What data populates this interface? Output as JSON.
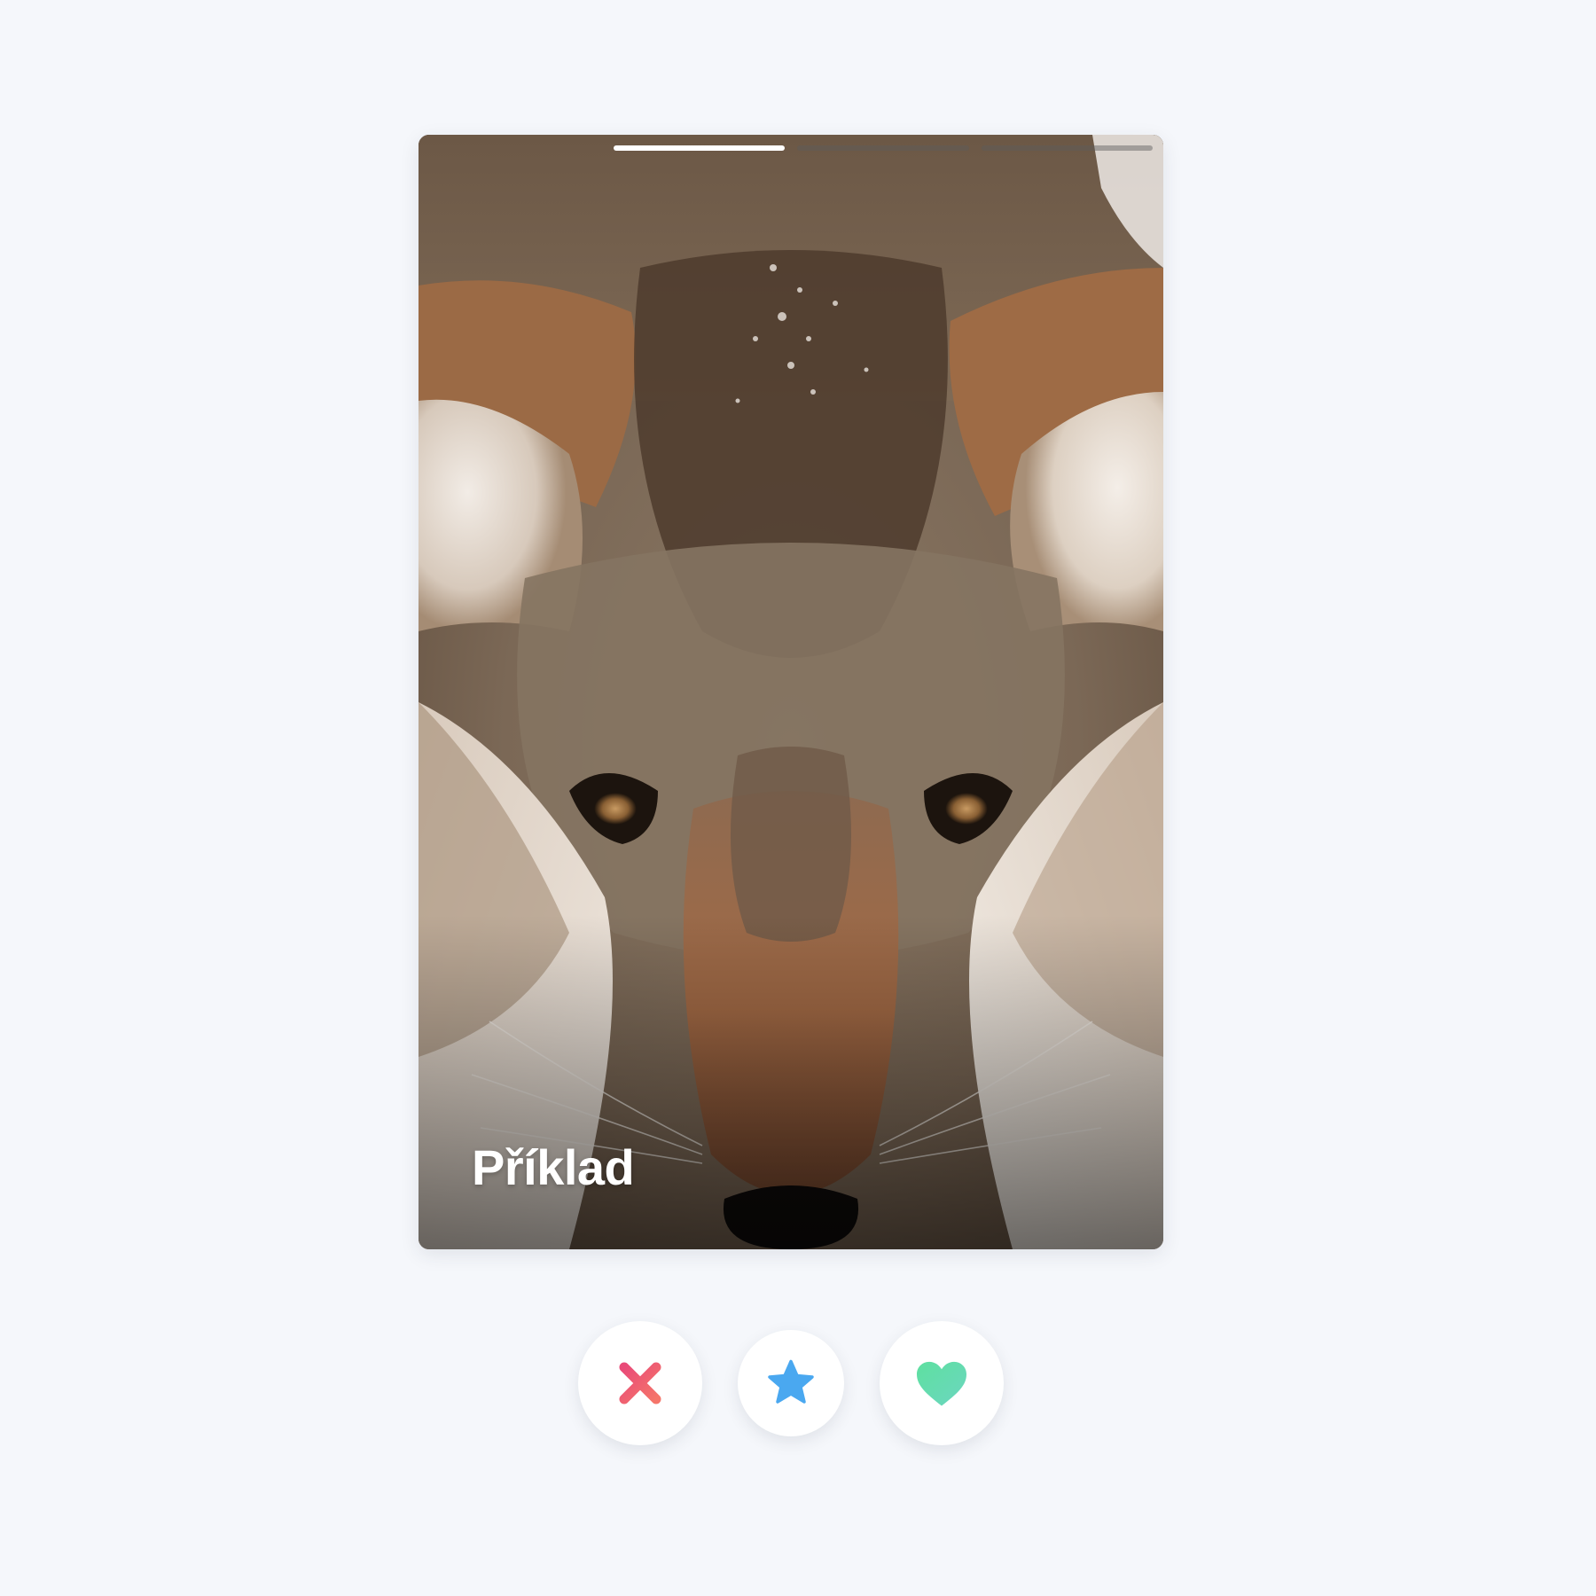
{
  "card": {
    "title": "Příklad",
    "photo_subject": "coyote-face",
    "progress": {
      "segments": 3,
      "active_index": 0
    }
  },
  "actions": {
    "nope": {
      "icon": "close-icon",
      "color_start": "#f5576c",
      "color_end": "#e94a78"
    },
    "super_like": {
      "icon": "star-icon",
      "color": "#4aa8f0"
    },
    "like": {
      "icon": "heart-icon",
      "color_start": "#5ee0a0",
      "color_end": "#6cd6c0"
    }
  },
  "colors": {
    "background": "#f5f7fb",
    "card_overlay_text": "#ffffff"
  }
}
